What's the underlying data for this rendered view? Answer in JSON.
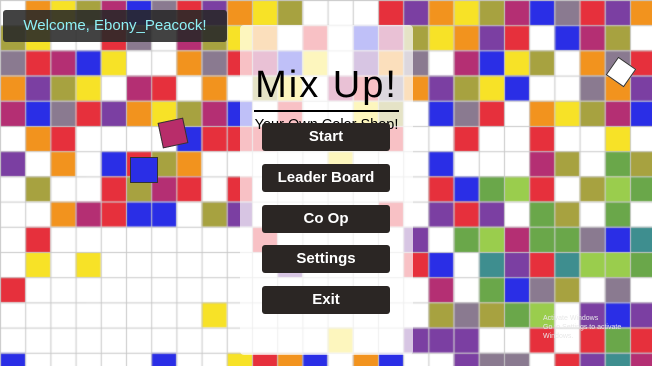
{
  "welcome": "Welcome, Ebony_Peacock!",
  "title": "Mix Up!",
  "subtitle": "Your Own Color Shop!",
  "menu": [
    "Start",
    "Leader Board",
    "Co Op",
    "Settings",
    "Exit"
  ],
  "watermark": {
    "line1": "Activate Windows",
    "line2": "Go to Settings to activate Windows."
  },
  "palette": {
    "white": "#ffffff",
    "purple": "#7b3fa2",
    "blue": "#2a2ee6",
    "yellow": "#f7e227",
    "red": "#e6303c",
    "magenta": "#b42f73",
    "orange": "#f2931e",
    "green": "#6aa74a",
    "grey": "#8a7a90",
    "olive": "#a7a240",
    "teal": "#3e8e8f",
    "lightgreen": "#9acd4d"
  }
}
